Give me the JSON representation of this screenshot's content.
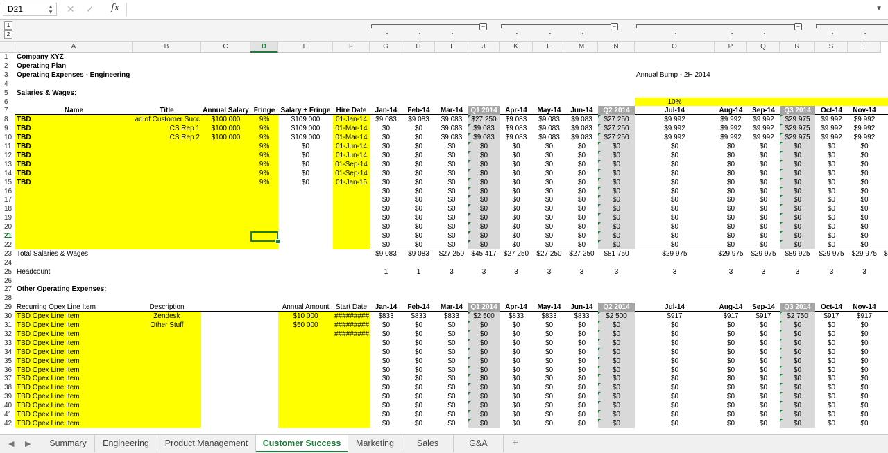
{
  "formula_bar": {
    "cell_ref": "D21",
    "fx": "fx",
    "formula": ""
  },
  "outline_levels": [
    "1",
    "2"
  ],
  "columns": [
    "A",
    "B",
    "C",
    "D",
    "E",
    "F",
    "G",
    "H",
    "I",
    "J",
    "K",
    "L",
    "M",
    "N",
    "O",
    "P",
    "Q",
    "R",
    "S",
    "T"
  ],
  "selected_column": "D",
  "selected_row": "21",
  "rows": [
    "1",
    "2",
    "3",
    "4",
    "5",
    "6",
    "7",
    "8",
    "9",
    "10",
    "11",
    "12",
    "13",
    "14",
    "15",
    "16",
    "17",
    "18",
    "19",
    "20",
    "21",
    "22",
    "23",
    "24",
    "25",
    "26",
    "27",
    "28",
    "29",
    "30",
    "31",
    "32",
    "33",
    "34",
    "35",
    "36",
    "37",
    "38",
    "39",
    "40",
    "41",
    "42"
  ],
  "header": {
    "company": "Company XYZ",
    "plan": "Operating Plan",
    "subtitle": "Operating Expenses - Engineering",
    "salaries_heading": "Salaries & Wages:",
    "annual_bump_label": "Annual Bump - 2H 2014",
    "annual_bump_value": "10%"
  },
  "salary_headers": [
    "Name",
    "Title",
    "Annual Salary",
    "Fringe",
    "Salary + Fringe",
    "Hire Date"
  ],
  "months": [
    "Jan-14",
    "Feb-14",
    "Mar-14",
    "Q1 2014",
    "Apr-14",
    "May-14",
    "Jun-14",
    "Q2 2014",
    "Jul-14",
    "Aug-14",
    "Sep-14",
    "Q3 2014",
    "Oct-14",
    "Nov-14"
  ],
  "employees": [
    {
      "name": "TBD",
      "title": "ad of Customer Succ",
      "salary": "$100 000",
      "fringe": "9%",
      "total": "$109 000",
      "hire": "01-Jan-14"
    },
    {
      "name": "TBD",
      "title": "CS Rep 1",
      "salary": "$100 000",
      "fringe": "9%",
      "total": "$109 000",
      "hire": "01-Mar-14"
    },
    {
      "name": "TBD",
      "title": "CS Rep 2",
      "salary": "$100 000",
      "fringe": "9%",
      "total": "$109 000",
      "hire": "01-Mar-14"
    },
    {
      "name": "TBD",
      "title": "",
      "salary": "",
      "fringe": "9%",
      "total": "$0",
      "hire": "01-Jun-14"
    },
    {
      "name": "TBD",
      "title": "",
      "salary": "",
      "fringe": "9%",
      "total": "$0",
      "hire": "01-Jun-14"
    },
    {
      "name": "TBD",
      "title": "",
      "salary": "",
      "fringe": "9%",
      "total": "$0",
      "hire": "01-Sep-14"
    },
    {
      "name": "TBD",
      "title": "",
      "salary": "",
      "fringe": "9%",
      "total": "$0",
      "hire": "01-Sep-14"
    },
    {
      "name": "TBD",
      "title": "",
      "salary": "",
      "fringe": "9%",
      "total": "$0",
      "hire": "01-Jan-15"
    }
  ],
  "salary_values": [
    [
      "$9 083",
      "$9 083",
      "$9 083",
      "$27 250",
      "$9 083",
      "$9 083",
      "$9 083",
      "$27 250",
      "$9 992",
      "$9 992",
      "$9 992",
      "$29 975",
      "$9 992",
      "$9 992"
    ],
    [
      "$0",
      "$0",
      "$9 083",
      "$9 083",
      "$9 083",
      "$9 083",
      "$9 083",
      "$27 250",
      "$9 992",
      "$9 992",
      "$9 992",
      "$29 975",
      "$9 992",
      "$9 992"
    ],
    [
      "$0",
      "$0",
      "$9 083",
      "$9 083",
      "$9 083",
      "$9 083",
      "$9 083",
      "$27 250",
      "$9 992",
      "$9 992",
      "$9 992",
      "$29 975",
      "$9 992",
      "$9 992"
    ]
  ],
  "zero": "$0",
  "total_salaries_label": "Total Salaries & Wages",
  "total_salaries": [
    "$9 083",
    "$9 083",
    "$27 250",
    "$45 417",
    "$27 250",
    "$27 250",
    "$27 250",
    "$81 750",
    "$29 975",
    "$29 975",
    "$29 975",
    "$89 925",
    "$29 975",
    "$29 975"
  ],
  "total_overflow": "$",
  "headcount_label": "Headcount",
  "headcount": [
    "1",
    "1",
    "3",
    "3",
    "3",
    "3",
    "3",
    "3",
    "3",
    "3",
    "3",
    "3",
    "3",
    "3"
  ],
  "opex_heading": "Other Operating Expenses:",
  "opex_headers": [
    "Recurring Opex Line Item",
    "Description",
    "Annual Amount",
    "Start Date"
  ],
  "opex_items": [
    {
      "name": "TBD Opex Line Item",
      "desc": "Zendesk",
      "amount": "$10 000",
      "start": "#########"
    },
    {
      "name": "TBD Opex Line Item",
      "desc": "Other Stuff",
      "amount": "$50 000",
      "start": "#########"
    },
    {
      "name": "TBD Opex Line Item",
      "desc": "",
      "amount": "",
      "start": "#########"
    },
    {
      "name": "TBD Opex Line Item",
      "desc": "",
      "amount": "",
      "start": ""
    },
    {
      "name": "TBD Opex Line Item",
      "desc": "",
      "amount": "",
      "start": ""
    },
    {
      "name": "TBD Opex Line Item",
      "desc": "",
      "amount": "",
      "start": ""
    },
    {
      "name": "TBD Opex Line Item",
      "desc": "",
      "amount": "",
      "start": ""
    },
    {
      "name": "TBD Opex Line Item",
      "desc": "",
      "amount": "",
      "start": ""
    },
    {
      "name": "TBD Opex Line Item",
      "desc": "",
      "amount": "",
      "start": ""
    },
    {
      "name": "TBD Opex Line Item",
      "desc": "",
      "amount": "",
      "start": ""
    },
    {
      "name": "TBD Opex Line Item",
      "desc": "",
      "amount": "",
      "start": ""
    },
    {
      "name": "TBD Opex Line Item",
      "desc": "",
      "amount": "",
      "start": ""
    },
    {
      "name": "TBD Opex Line Item",
      "desc": "",
      "amount": "",
      "start": ""
    }
  ],
  "opex_first_row": [
    "$833",
    "$833",
    "$833",
    "$2 500",
    "$833",
    "$833",
    "$833",
    "$2 500",
    "$917",
    "$917",
    "$917",
    "$2 750",
    "$917",
    "$917"
  ],
  "sheet_tabs": [
    "Summary",
    "Engineering",
    "Product Management",
    "Customer Success",
    "Marketing",
    "Sales",
    "G&A"
  ],
  "active_tab": "Customer Success",
  "add_tab": "+",
  "colors": {
    "highlight": "#ffff00",
    "quarter": "#d9d9d9",
    "accent": "#1d7b38"
  }
}
